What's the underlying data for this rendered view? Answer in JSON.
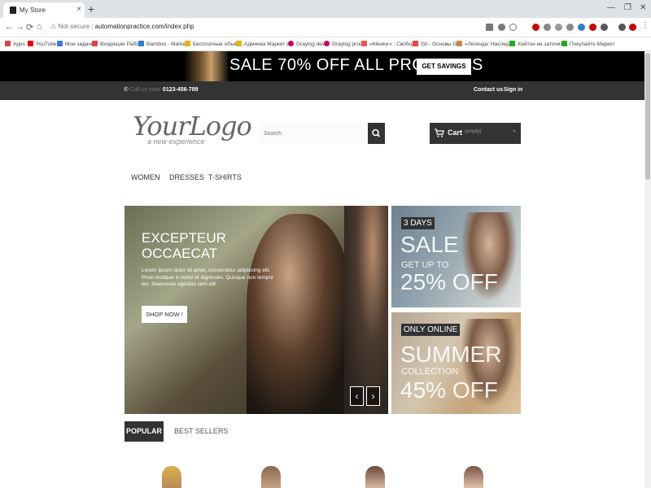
{
  "browser": {
    "tab_title": "My Store",
    "tab_close": "×",
    "new_tab": "+",
    "window_controls": [
      "—",
      "❐",
      "✕"
    ],
    "nav": {
      "back": "←",
      "forward": "→",
      "reload": "⟳",
      "home": "⌂"
    },
    "address": {
      "security": "Not secure",
      "separator": "|",
      "url": "automationpractice.com/index.php"
    },
    "bookmarks": [
      "Apps",
      "YouTube",
      "Мои задачи",
      "Входящие Работа",
      "Bamboo - Market",
      "Бесплатные объяв...",
      "Админка Маркет d...",
      "Graylog dev",
      "Graylog prod",
      "«Кёнинг» : Свобод...",
      "Git - Основы Git",
      "«Легенда: Наследн...",
      "Хейтон не заточить...",
      "Покупайте Маркет"
    ]
  },
  "promo": {
    "text": "SALE 70% OFF ALL PRODUCTS",
    "button": "GET SAVINGS NOW"
  },
  "header": {
    "phone_label": "Call us now:",
    "phone_number": "0123-456-789",
    "contact": "Contact us",
    "signin": "Sign in",
    "logo_main": "YourLogo",
    "logo_sub": "a new experience",
    "search_placeholder": "Search",
    "cart_label": "Cart",
    "cart_count": "(empty)",
    "cart_chevron": "»"
  },
  "menu": [
    "WOMEN",
    "DRESSES",
    "T-SHIRTS"
  ],
  "slider": {
    "title_line1": "EXCEPTEUR",
    "title_line2": "OCCAECAT",
    "body": "Lorem ipsum dolor sit amet, consectetur adipiscing elit. Proin tristique in tortor et dignissim. Quisque non tempor leo. Maecenas egestas sem elit",
    "button": "SHOP NOW !",
    "prev": "‹",
    "next": "›"
  },
  "banners": [
    {
      "tag": "3 DAYS",
      "big1": "SALE",
      "mid": "GET UP TO",
      "big2": "25% OFF"
    },
    {
      "tag": "ONLY ONLINE",
      "big1": "SUMMER",
      "mid": "COLLECTION",
      "big2": "45% OFF"
    }
  ],
  "product_tabs": [
    "POPULAR",
    "BEST SELLERS"
  ],
  "colors": {
    "dark": "#333333",
    "promo_bg": "#000000",
    "page_bg": "#ffffff"
  }
}
